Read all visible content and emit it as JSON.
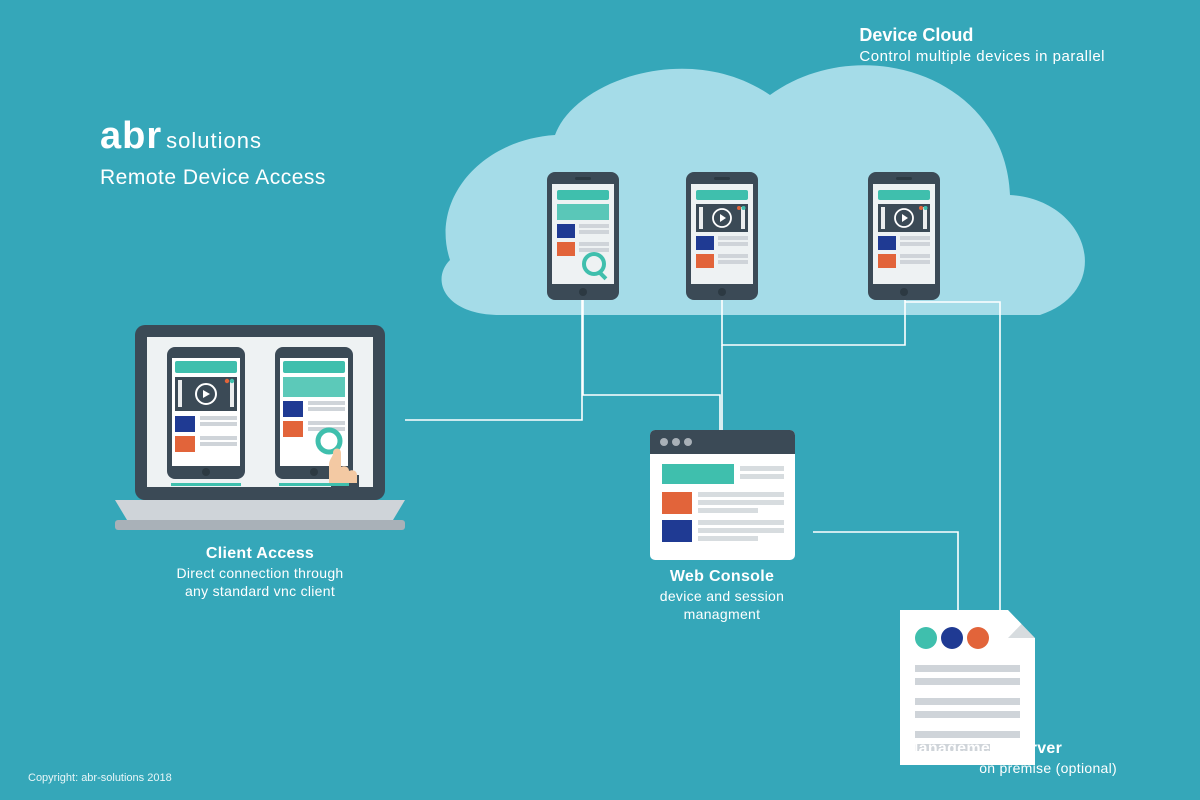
{
  "brand": {
    "bold": "abr",
    "thin": "solutions"
  },
  "product": "Remote Device Access",
  "cloud": {
    "title": "Device Cloud",
    "sub": "Control multiple devices in parallel"
  },
  "client": {
    "title": "Client Access",
    "sub1": "Direct connection through",
    "sub2": "any standard vnc client"
  },
  "console": {
    "title": "Web Console",
    "sub1": "device and session",
    "sub2": "managment"
  },
  "server": {
    "title": "Management Server",
    "sub": "on premise (optional)"
  },
  "copyright": "Copyright: abr-solutions 2018",
  "colors": {
    "bg": "#35a7b9",
    "cloud": "#a5dce8",
    "darkSlate": "#3b4a56",
    "teal": "#3fbfad",
    "navy": "#1f3a93",
    "orange": "#e2643a",
    "line": "#cfcfcf",
    "panel": "#ffffff",
    "grey": "#bfc6cc"
  }
}
